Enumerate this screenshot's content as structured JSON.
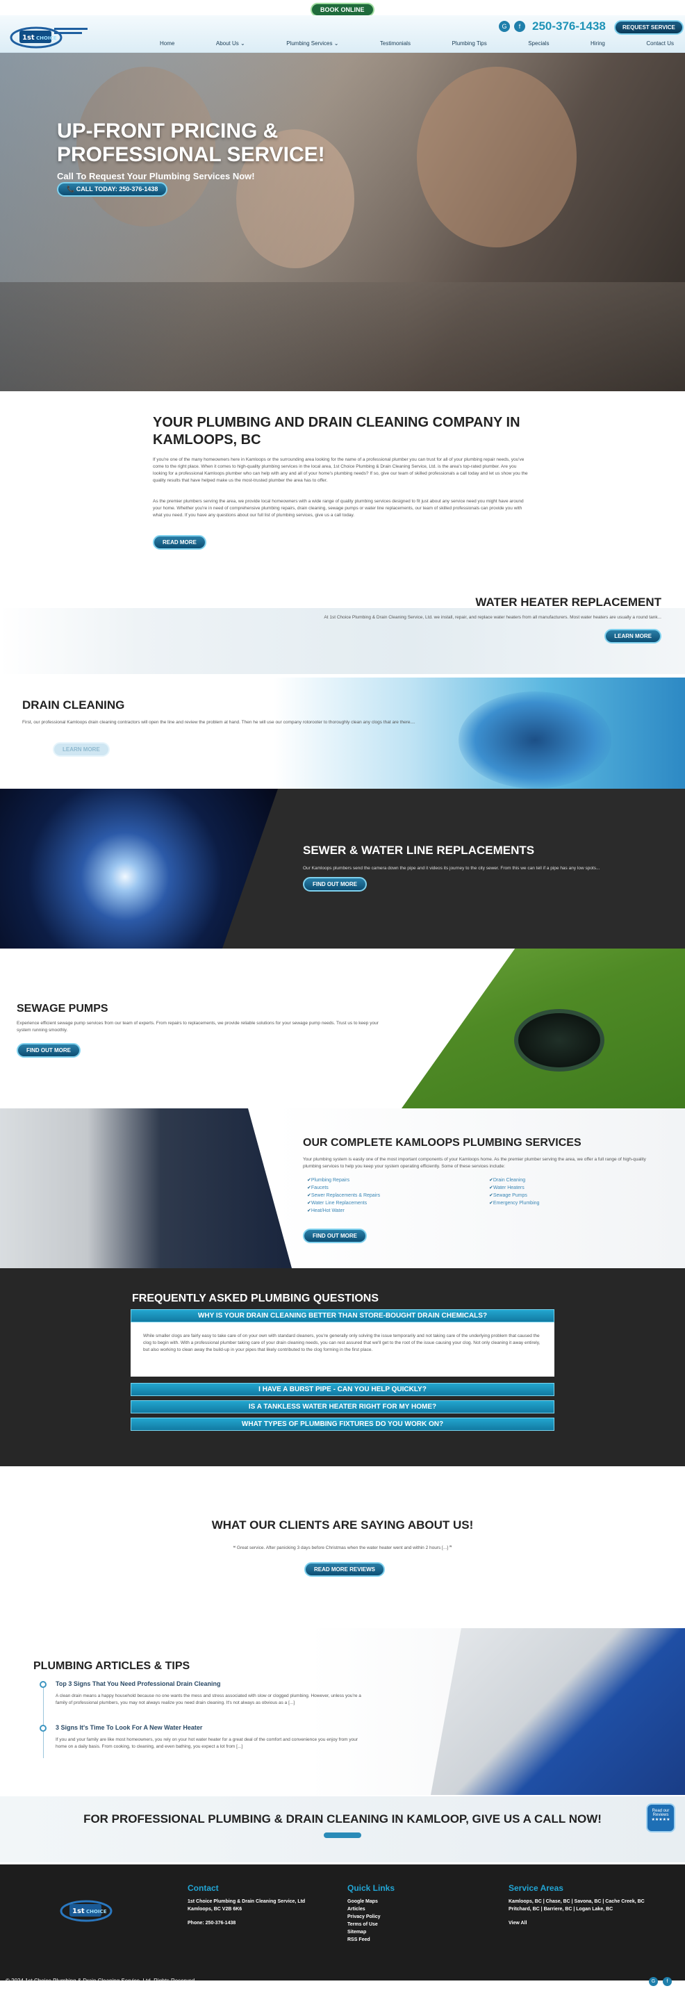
{
  "top": {
    "book_label": "BOOK ONLINE"
  },
  "header": {
    "phone": "250-376-1438",
    "request_label": "REQUEST SERVICE",
    "logo_text": "1st Choice",
    "nav": [
      "Home",
      "About Us ⌄",
      "Plumbing Services ⌄",
      "Testimonials",
      "Plumbing Tips",
      "Specials",
      "Hiring",
      "Contact Us"
    ]
  },
  "hero": {
    "title": "UP-FRONT PRICING & PROFESSIONAL SERVICE!",
    "subtitle": "Call To Request Your Plumbing Services Now!",
    "call_label": "📞 CALL TODAY: 250-376-1438"
  },
  "about": {
    "title": "YOUR PLUMBING AND DRAIN CLEANING COMPANY IN KAMLOOPS, BC",
    "p1": "If you're one of the many homeowners here in Kamloops or the surrounding area looking for the name of a professional plumber you can trust for all of your plumbing repair needs, you've come to the right place. When it comes to high-quality plumbing services in the local area, 1st Choice Plumbing & Drain Cleaning Service, Ltd. is the area's top-rated plumber. Are you looking for a professional Kamloops plumber who can help with any and all of your home's plumbing needs? If so, give our team of skilled professionals a call today and let us show you the quality results that have helped make us the most-trusted plumber the area has to offer.",
    "p2": "As the premier plumbers serving the area, we provide local homeowners with a wide range of quality plumbing services designed to fit just about any service need you might have around your home. Whether you're in need of comprehensive plumbing repairs, drain cleaning, sewage pumps or water line replacements, our team of skilled professionals can provide you with what you need. If you have any questions about our full list of plumbing services, give us a call today.",
    "button": "READ MORE"
  },
  "water_heater": {
    "title": "WATER HEATER REPLACEMENT",
    "text": "At 1st Choice Plumbing & Drain Cleaning Service, Ltd. we install, repair, and replace water heaters from all manufacturers. Most water heaters are usually a round tank...",
    "button": "LEARN MORE"
  },
  "drain": {
    "title": "DRAIN CLEANING",
    "text": "First, our professional Kamloops drain cleaning contractors will open the line and review the problem at hand. Then he will use our company rotorooter to thoroughly clean any clogs that are there....",
    "button": "LEARN MORE"
  },
  "sewer": {
    "title": "SEWER & WATER LINE REPLACEMENTS",
    "text": "Our Kamloops plumbers send the camera down the pipe and it videos its journey to the city sewer. From this we can tell if a pipe has any low spots...",
    "button": "FIND OUT MORE"
  },
  "sewage": {
    "title": "SEWAGE PUMPS",
    "text": "Experience efficient sewage pump services from our team of experts. From repairs to replacements, we provide reliable solutions for your sewage pump needs. Trust us to keep your system running smoothly.",
    "button": "FIND OUT MORE"
  },
  "services": {
    "title": "OUR COMPLETE KAMLOOPS PLUMBING SERVICES",
    "text": "Your plumbing system is easily one of the most important components of your Kamloops home. As the premier plumber serving the area, we offer a full range of high-quality plumbing services to help you keep your system operating efficiently. Some of these services include:",
    "list1": [
      "Plumbing Repairs",
      "Faucets",
      "Sewer Replacements & Repairs",
      "Water Line Replacements",
      "Heat/Hot Water"
    ],
    "list2": [
      "Drain Cleaning",
      "Water Heaters",
      "Sewage Pumps",
      "Emergency Plumbing"
    ],
    "button": "FIND OUT MORE"
  },
  "faq": {
    "title": "FREQUENTLY ASKED PLUMBING QUESTIONS",
    "q1": "WHY IS YOUR DRAIN CLEANING BETTER THAN STORE-BOUGHT DRAIN CHEMICALS?",
    "a1": "While smaller clogs are fairly easy to take care of on your own with standard cleaners, you're generally only solving the issue temporarily and not taking care of the underlying problem that caused the clog to begin with. With a professional plumber taking care of your drain cleaning needs, you can rest assured that we'll get to the root of the issue causing your clog. Not only cleaning it away entirely, but also working to clean away the build-up in your pipes that likely contributed to the clog forming in the first place.",
    "q2": "I HAVE A BURST PIPE - CAN YOU HELP QUICKLY?",
    "q3": "IS A TANKLESS WATER HEATER RIGHT FOR MY HOME?",
    "q4": "WHAT TYPES OF PLUMBING FIXTURES DO YOU WORK ON?"
  },
  "reviews": {
    "title": "WHAT OUR CLIENTS ARE SAYING ABOUT US!",
    "quote": "❝ Great service. After panicking 3 days before Christmas when the water heater went and within 2 hours [...] ❞",
    "button": "READ MORE REVIEWS"
  },
  "articles": {
    "title": "PLUMBING ARTICLES & TIPS",
    "a1_title": "Top 3 Signs That You Need Professional Drain Cleaning",
    "a1_text": "A clean drain means a happy household because no one wants the mess and stress associated with slow or clogged plumbing. However, unless you're a family of professional plumbers, you may not always realize you need drain cleaning. It's not always as obvious as a [...]",
    "a2_title": "3 Signs It's Time To Look For A New Water Heater",
    "a2_text": "If you and your family are like most homeowners, you rely on your hot water heater for a great deal of the comfort and convenience you enjoy from your home on a daily basis. From cooking, to cleaning, and even bathing, you expect a lot from [...]"
  },
  "cta": {
    "title": "FOR PROFESSIONAL PLUMBING & DRAIN CLEANING IN KAMLOOP, GIVE US A CALL NOW!",
    "badge": "Read our Reviews ★★★★★"
  },
  "footer": {
    "contact_h": "Contact",
    "contact_1": "1st Choice Plumbing & Drain Cleaning Service, Ltd",
    "contact_2": "Kamloops, BC V2B 6K6",
    "contact_3": "Phone: 250-376-1438",
    "links_h": "Quick Links",
    "links": [
      "Google Maps",
      "Articles",
      "Privacy Policy",
      "Terms of Use",
      "Sitemap",
      "RSS Feed"
    ],
    "areas_h": "Service Areas",
    "areas_1": "Kamloops, BC | Chase, BC | Savona, BC | Cache Creek, BC",
    "areas_2": "Pritchard, BC | Barriere, BC | Logan Lake, BC",
    "areas_3": "View All",
    "copyright": "© 2024 1st Choice Plumbing & Drain Cleaning Service, Ltd. Rights Reserved"
  },
  "colors": {
    "accent": "#1f93b7",
    "dark": "#272727",
    "faq_bar": "#23a6cf"
  }
}
